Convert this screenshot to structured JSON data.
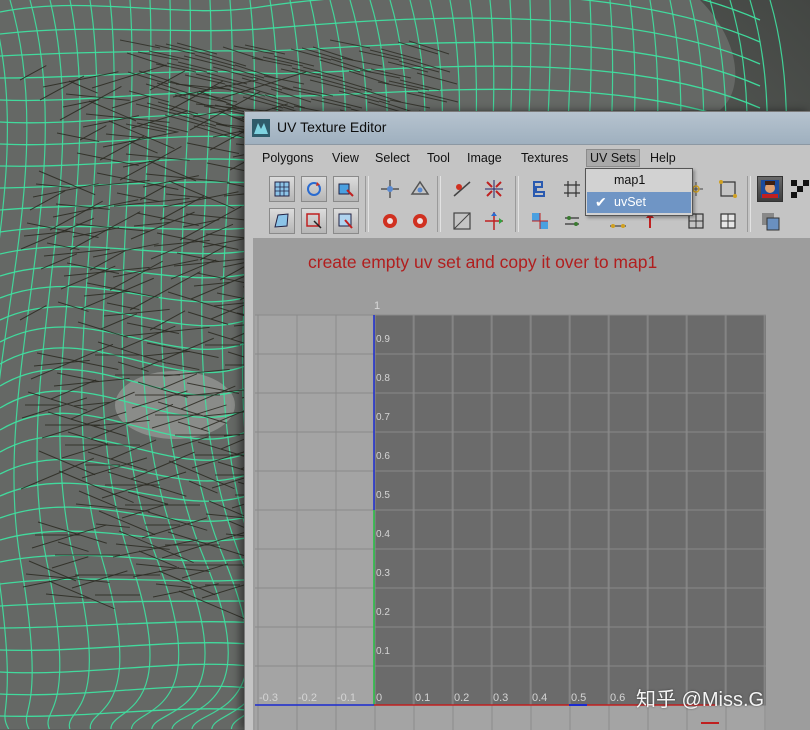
{
  "window": {
    "title": "UV Texture Editor"
  },
  "menu": [
    {
      "label": "Polygons"
    },
    {
      "label": "View"
    },
    {
      "label": "Select"
    },
    {
      "label": "Tool"
    },
    {
      "label": "Image"
    },
    {
      "label": "Textures"
    },
    {
      "label": "UV Sets",
      "open": true
    },
    {
      "label": "Help"
    }
  ],
  "uv_sets_menu": {
    "items": [
      {
        "label": "map1",
        "checked": false,
        "selected": false
      },
      {
        "label": "uvSet",
        "checked": true,
        "selected": true
      }
    ]
  },
  "annotation": "create empty uv set and copy it over to map1",
  "grid": {
    "top_label": "1",
    "v_labels": [
      "0.9",
      "0.8",
      "0.7",
      "0.6",
      "0.5",
      "0.4",
      "0.3",
      "0.2",
      "0.1"
    ],
    "u_labels": [
      "-0.3",
      "-0.2",
      "-0.1",
      "0",
      "0.1",
      "0.2",
      "0.3",
      "0.4",
      "0.5",
      "0.6"
    ]
  },
  "watermark": "知乎 @Miss.G",
  "colors": {
    "annotation": "#b11e1e",
    "wireframe": "#3fe0a0",
    "uv_tile": "#6b6b6b",
    "axis_u": "#c02020",
    "axis_v": "#1a2ad0",
    "axis_v_green": "#22c040",
    "dropdown_highlight": "#6f95c5"
  }
}
